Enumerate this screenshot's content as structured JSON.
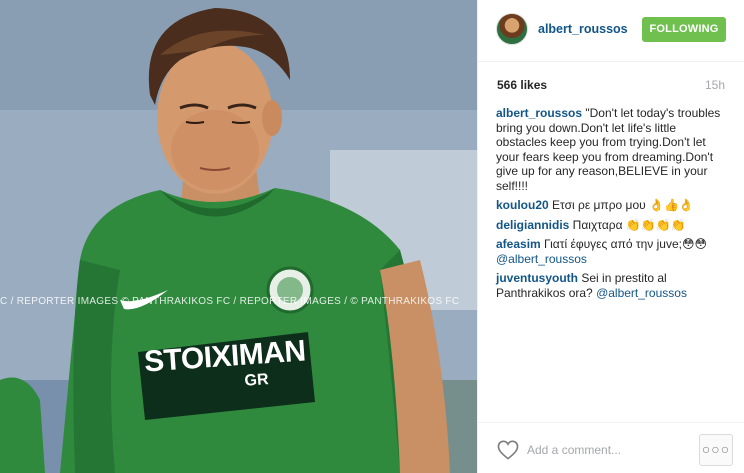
{
  "photo": {
    "watermark": "C / REPORTER IMAGES © PANTHRAKIKOS FC / REPORTER IMAGES / © PANTHRAKIKOS FC",
    "sponsor_main": "STOIXIMAN",
    "sponsor_sub": "GR"
  },
  "header": {
    "username": "albert_roussos",
    "follow_label": "FOLLOWING"
  },
  "stats": {
    "likes": "566 likes",
    "time": "15h"
  },
  "caption": {
    "user": "albert_roussos",
    "text": " \"Don't let today's troubles bring you down.Don't let life's little obstacles keep you from trying.Don't let your fears keep you from dreaming.Don't give up for any reason,BELIEVE in your self!!!!"
  },
  "comments": [
    {
      "user": "koulou20",
      "text": " Ετσι ρε μπρο μου 👌👍👌"
    },
    {
      "user": "deligiannidis",
      "text": " Παιχταρα 👏👏👏👏"
    },
    {
      "user": "afeasim",
      "text": " Γιατί έφυγες από την juve;😳😳 ",
      "mention": "@albert_roussos"
    },
    {
      "user": "juventusyouth",
      "text": " Sei in prestito al Panthrakikos ora? ",
      "mention": "@albert_roussos"
    }
  ],
  "footer": {
    "comment_placeholder": "Add a comment...",
    "more_label": "○○○",
    "heart_icon": "heart-outline-icon"
  },
  "colors": {
    "follow_green": "#70c050",
    "link_blue": "#125688",
    "muted_gray": "#a5a7aa",
    "jersey_green": "#2f8a3e"
  }
}
